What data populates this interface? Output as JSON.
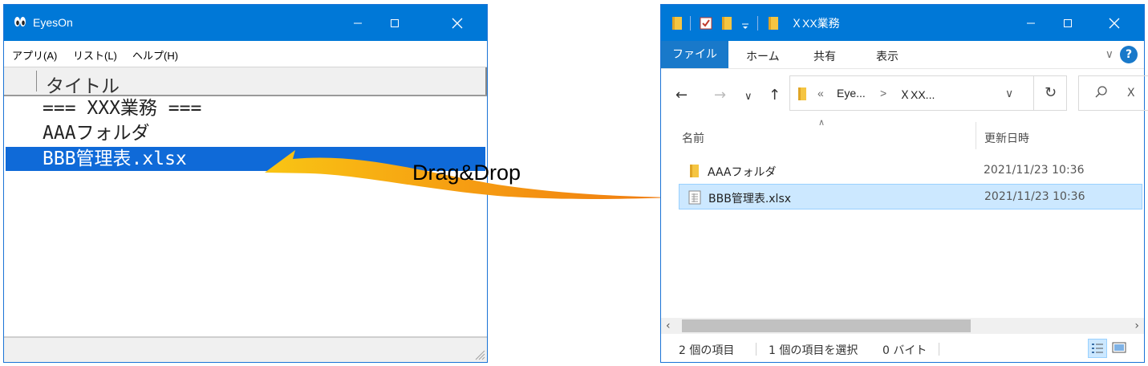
{
  "eyeson": {
    "title": "EyesOn",
    "menu": [
      "アプリ(A)",
      "リスト(L)",
      "ヘルプ(H)"
    ],
    "column_header": "タイトル",
    "rows": [
      {
        "text": "=== XXX業務 ===",
        "selected": false
      },
      {
        "text": "AAAフォルダ",
        "selected": false
      },
      {
        "text": "BBB管理表.xlsx",
        "selected": true
      }
    ]
  },
  "drag": {
    "label": "Drag&Drop"
  },
  "explorer": {
    "title": "ＸXX業務",
    "ribbon_tabs": {
      "file": "ファイル",
      "home": "ホーム",
      "share": "共有",
      "view": "表示"
    },
    "help": "?",
    "address": {
      "ellipsis": "«",
      "seg1": "Eye...",
      "sep": ">",
      "seg2": "ＸXX..."
    },
    "search_placeholder": "X",
    "columns": {
      "name": "名前",
      "date": "更新日時"
    },
    "files": [
      {
        "name": "AAAフォルダ",
        "date": "2021/11/23 10:36",
        "icon": "folder-icon",
        "selected": false
      },
      {
        "name": "BBB管理表.xlsx",
        "date": "2021/11/23 10:36",
        "icon": "file-icon",
        "selected": true
      }
    ],
    "status": {
      "count": "2 個の項目",
      "selection": "1 個の項目を選択",
      "size": "0 バイト"
    }
  },
  "colors": {
    "titlebar": "#0078d7",
    "selection_blue": "#0f6ad8",
    "explorer_selection": "#cce8ff",
    "arrow_start": "#f7c21a",
    "arrow_end": "#f07a10"
  }
}
